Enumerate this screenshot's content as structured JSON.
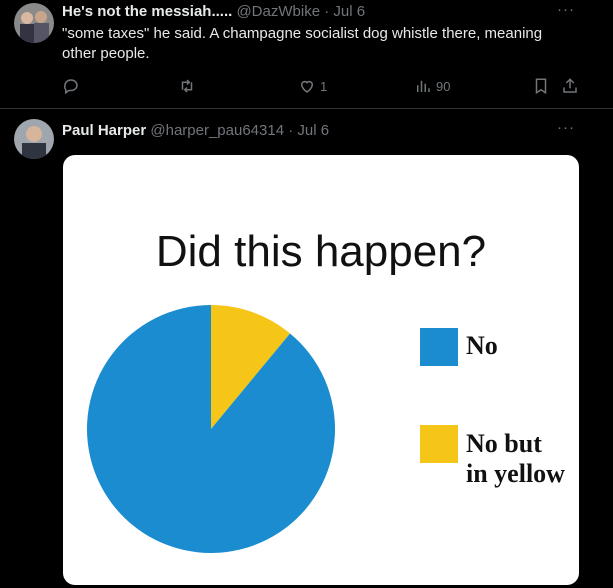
{
  "tweets": [
    {
      "name": "He's not the messiah.....",
      "handle": "@DazWbike",
      "separator": "·",
      "time": "Jul 6",
      "text": "\"some taxes\" he said. A champagne socialist dog whistle there, meaning other people.",
      "more": "···",
      "actions": {
        "reply_count": "",
        "retweet_count": "",
        "like_count": "1",
        "views_count": "90"
      }
    },
    {
      "name": "Paul Harper",
      "handle": "@harper_pau64314",
      "separator": "·",
      "time": "Jul 6",
      "more": "···"
    }
  ],
  "icons": {
    "reply": "reply-icon",
    "retweet": "retweet-icon",
    "like": "heart-icon",
    "views": "views-icon",
    "bookmark": "bookmark-icon",
    "share": "share-icon"
  },
  "colors": {
    "pie_blue": "#1a8ccf",
    "pie_yellow": "#f5c518",
    "muted": "#71767b"
  },
  "chart_data": {
    "type": "pie",
    "title": "Did this happen?",
    "categories": [
      "No",
      "No but in yellow"
    ],
    "values": [
      89,
      11
    ],
    "colors": [
      "#1a8ccf",
      "#f5c518"
    ],
    "legend": [
      {
        "label": "No",
        "color": "#1a8ccf"
      },
      {
        "label_line1": "No but",
        "label_line2": "in yellow",
        "color": "#f5c518"
      }
    ],
    "legend_position": "right"
  }
}
